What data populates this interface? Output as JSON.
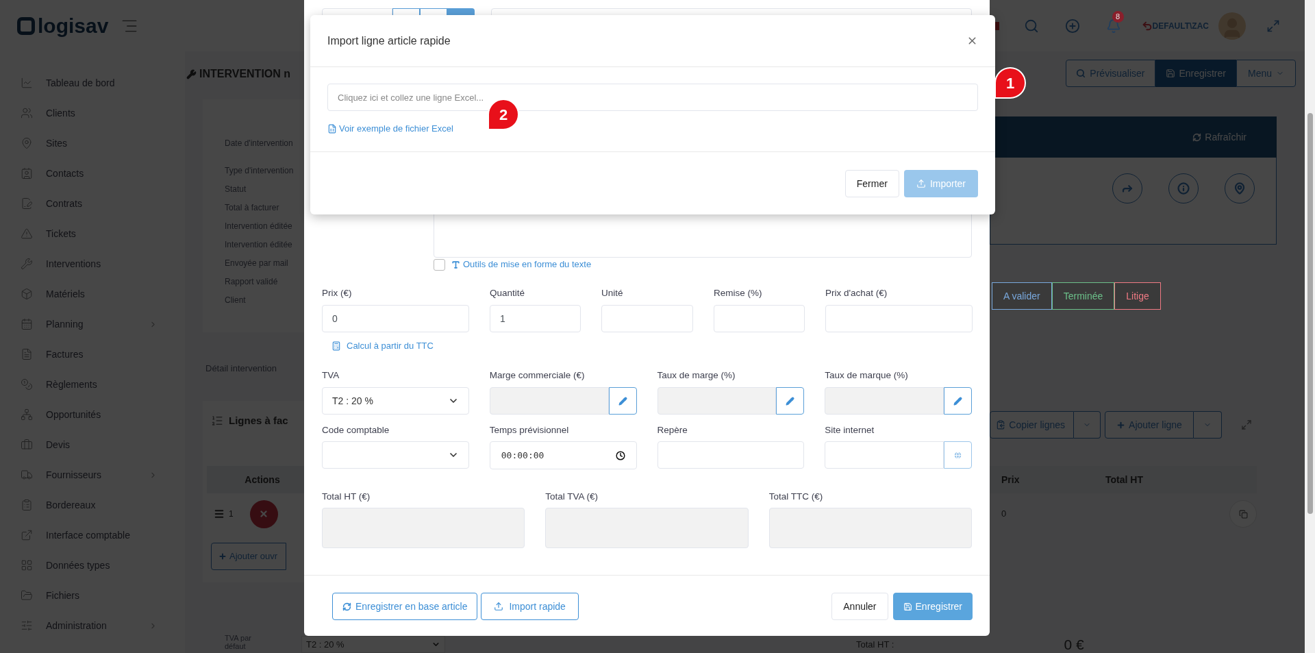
{
  "header": {
    "logo": "logisav",
    "notifications": "8",
    "user": "DEFAULT\\ZAC"
  },
  "sidebar": {
    "items": [
      {
        "label": "Tableau de bord",
        "expandable": false
      },
      {
        "label": "Clients",
        "expandable": false
      },
      {
        "label": "Sites",
        "expandable": false
      },
      {
        "label": "Contacts",
        "expandable": false
      },
      {
        "label": "Contrats",
        "expandable": false
      },
      {
        "label": "Tickets",
        "expandable": false
      },
      {
        "label": "Interventions",
        "expandable": false
      },
      {
        "label": "Matériels",
        "expandable": false
      },
      {
        "label": "Planning",
        "expandable": true
      },
      {
        "label": "Factures",
        "expandable": false
      },
      {
        "label": "Règlements",
        "expandable": false
      },
      {
        "label": "Opportunités",
        "expandable": false
      },
      {
        "label": "Devis",
        "expandable": false
      },
      {
        "label": "Fournisseurs",
        "expandable": true
      },
      {
        "label": "Bordereaux",
        "expandable": false
      },
      {
        "label": "Interface comptable",
        "expandable": false
      },
      {
        "label": "Données types",
        "expandable": false
      },
      {
        "label": "Fichiers",
        "expandable": false
      },
      {
        "label": "Administration",
        "expandable": true
      }
    ]
  },
  "page": {
    "title": "INTERVENTION n",
    "fields": [
      "Date d'intervention",
      "Type d'intervention",
      "Statut",
      "Total à facturer",
      "Intervention éditée",
      "Intervention éditée",
      "Envoyée par mail",
      "Rapport validé",
      "Client"
    ],
    "tab": "Détail intervention",
    "lines_title": "Lignes à fac",
    "table_header": "Actions",
    "row_number": "1",
    "add_work_button": "Ajouter ouvr",
    "default_vat_label": "TVA par défaut",
    "default_vat_value": "T2 : 20 %"
  },
  "right": {
    "actions": [
      {
        "label": "Prévisualiser",
        "kind": "preview"
      },
      {
        "label": "Enregistrer",
        "kind": "save"
      },
      {
        "label": "Menu",
        "kind": "dropdown"
      }
    ],
    "refresh": "Rafraîchir",
    "statuses": [
      {
        "label": "A valider",
        "color": "#79a8dc"
      },
      {
        "label": "Terminée",
        "color": "#6cc08a"
      },
      {
        "label": "Litige",
        "color": "#f07a84"
      }
    ],
    "copy_lines": "Copier lignes",
    "add_line": "Ajouter ligne",
    "table_columns": [
      "Prix",
      "Total HT"
    ],
    "row_values": [
      "0"
    ],
    "total_label": "Total HT :",
    "total_value": "0 €"
  },
  "article_modal": {
    "format_tools": {
      "label": "Outils de mise en forme du texte",
      "checked": false
    },
    "rows": [
      {
        "fields": [
          {
            "label": "Prix (€)",
            "kind": "input",
            "value": "0"
          },
          {
            "label": "Quantité",
            "kind": "input",
            "value": "1"
          },
          {
            "label": "Unité",
            "kind": "input"
          },
          {
            "label": "Remise (%)",
            "kind": "input"
          },
          {
            "label": "Prix d'achat (€)",
            "kind": "input"
          }
        ]
      },
      {
        "fields": [
          {
            "label": "TVA",
            "kind": "select",
            "value": "T2 : 20 %"
          },
          {
            "label": "Marge commerciale (€)",
            "kind": "edit"
          },
          {
            "label": "Taux de marge (%)",
            "kind": "edit"
          },
          {
            "label": "Taux de marque (%)",
            "kind": "edit"
          }
        ]
      },
      {
        "fields": [
          {
            "label": "Code comptable",
            "kind": "select"
          },
          {
            "label": "Temps prévisionnel",
            "kind": "time",
            "value": "00:00:00"
          },
          {
            "label": "Repère",
            "kind": "input"
          },
          {
            "label": "Site internet",
            "kind": "web"
          }
        ]
      },
      {
        "fields": [
          {
            "label": "Total HT (€)",
            "kind": "total"
          },
          {
            "label": "Total TVA (€)",
            "kind": "total"
          },
          {
            "label": "Total TTC (€)",
            "kind": "total"
          }
        ]
      }
    ],
    "calc_link": "Calcul à partir du TTC",
    "footer_left": [
      {
        "label": "Enregistrer en base article",
        "kind": "refresh"
      },
      {
        "label": "Import rapide",
        "kind": "upload"
      }
    ],
    "footer_right": [
      {
        "label": "Annuler",
        "kind": "default"
      },
      {
        "label": "Enregistrer",
        "kind": "primary"
      }
    ]
  },
  "import_modal": {
    "title": "Import ligne article rapide",
    "placeholder": "Cliquez ici et collez une ligne Excel...",
    "example_link": "Voir exemple de fichier Excel",
    "buttons": [
      {
        "label": "Fermer",
        "kind": "default",
        "disabled": false
      },
      {
        "label": "Importer",
        "kind": "primary",
        "disabled": true
      }
    ]
  },
  "callouts": [
    "1",
    "2"
  ]
}
